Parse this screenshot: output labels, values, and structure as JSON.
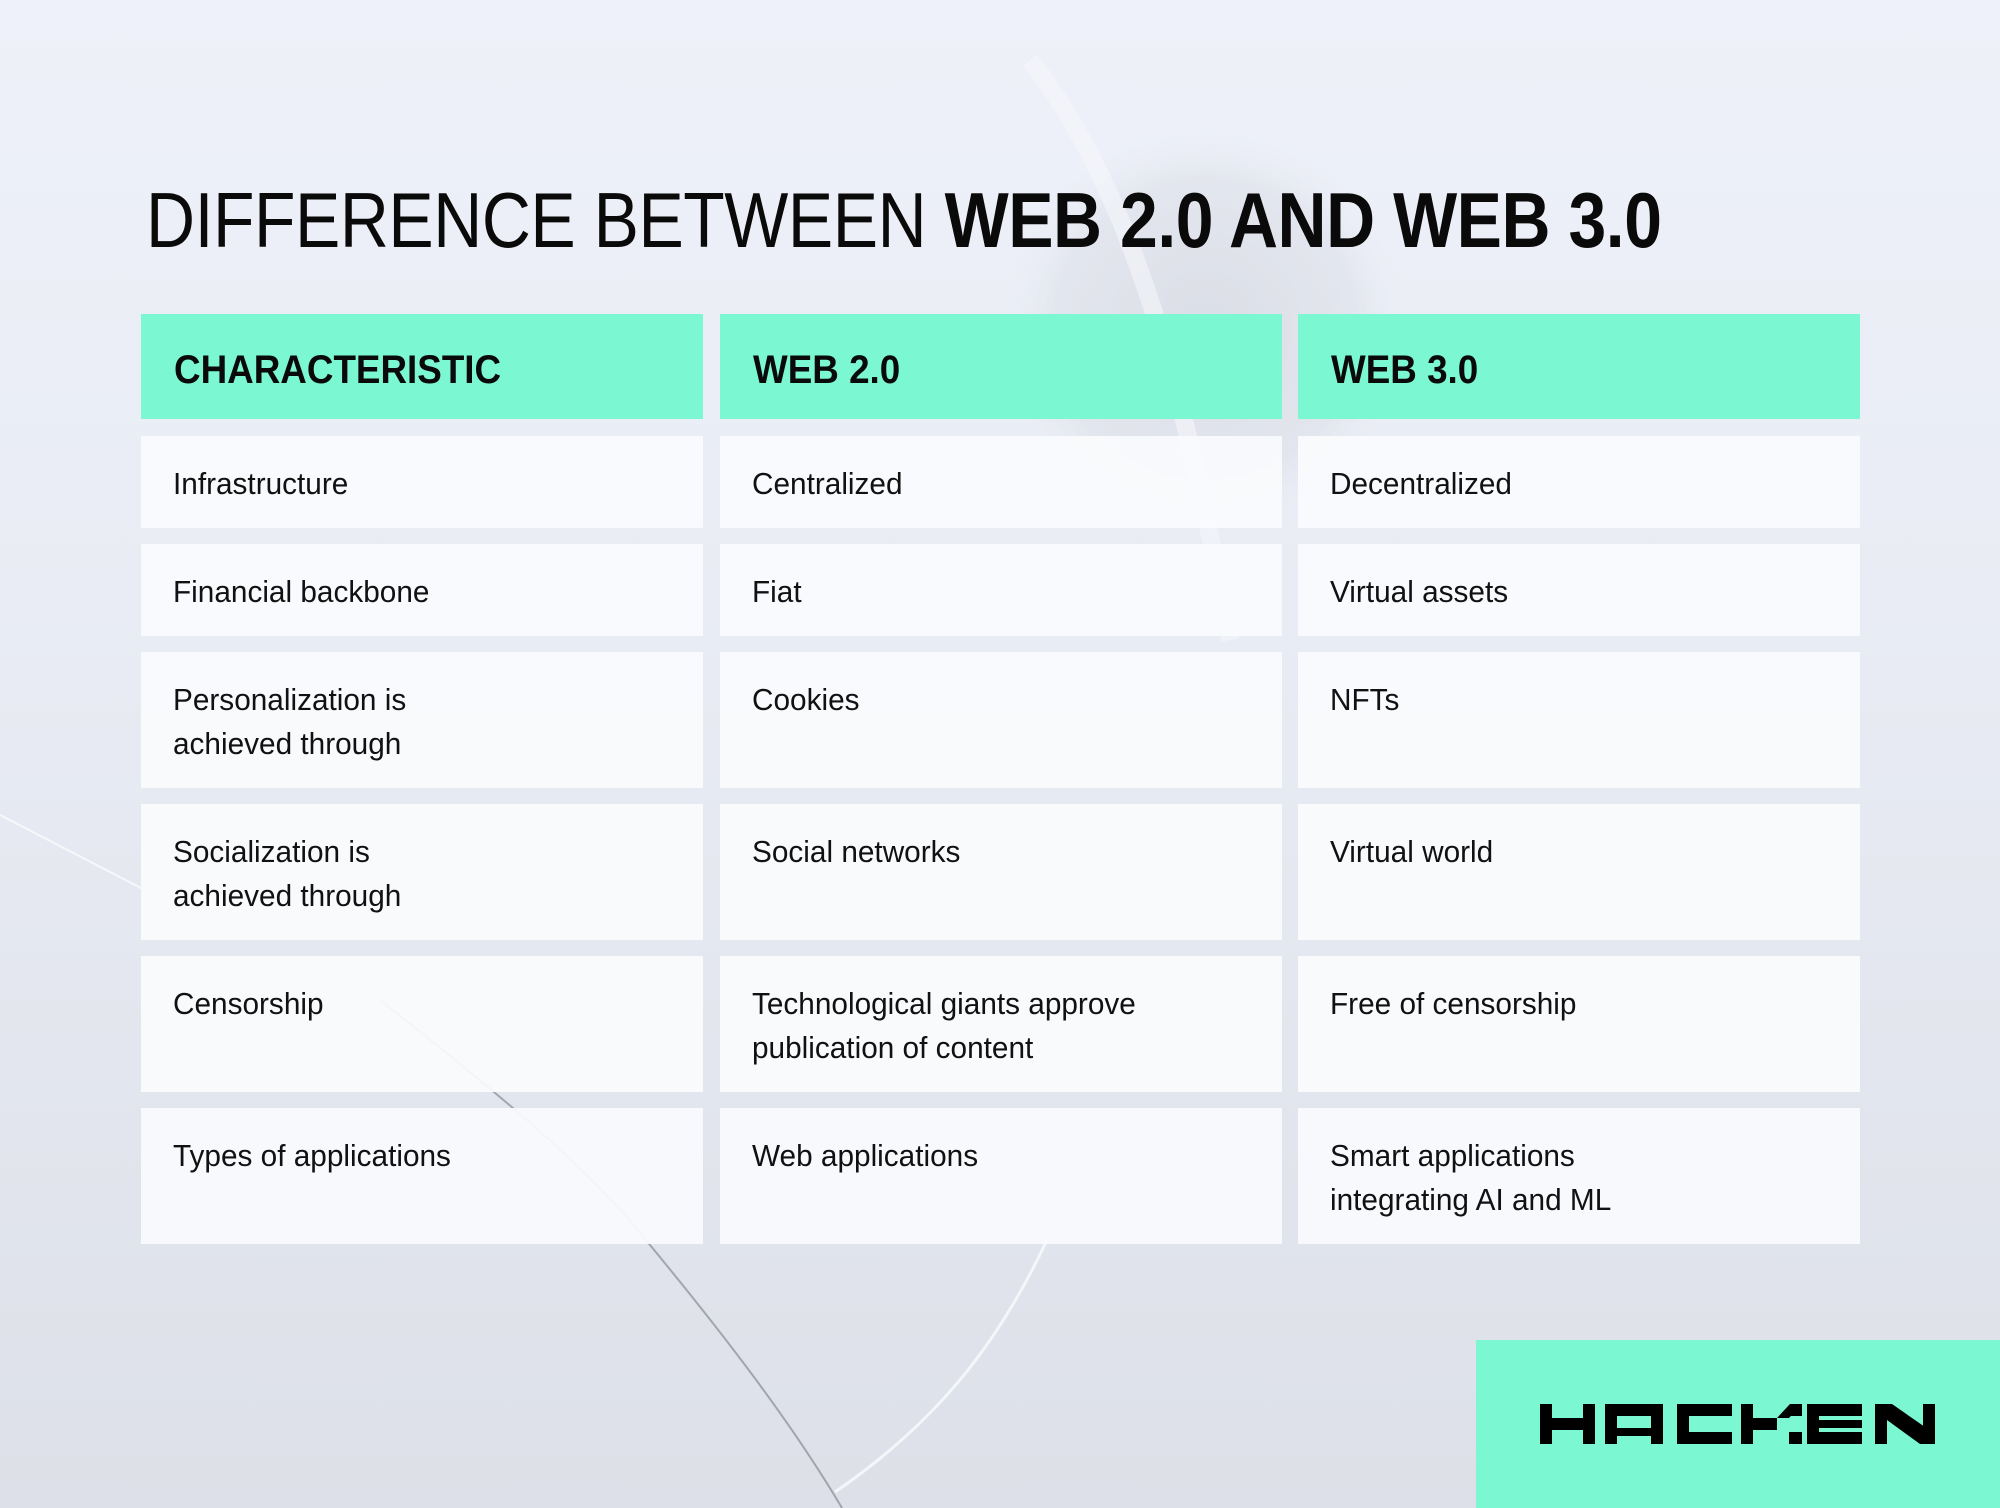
{
  "title": {
    "light": "DIFFERENCE BETWEEN ",
    "bold": "WEB 2.0 AND WEB 3.0"
  },
  "table": {
    "headers": [
      "CHARACTERISTIC",
      "WEB 2.0",
      "WEB 3.0"
    ],
    "rows": [
      [
        "Infrastructure",
        "Centralized",
        "Decentralized"
      ],
      [
        "Financial backbone",
        "Fiat",
        "Virtual assets"
      ],
      [
        "Personalization is\nachieved through",
        "Cookies",
        "NFTs"
      ],
      [
        "Socialization is\nachieved through",
        "Social networks",
        "Virtual world"
      ],
      [
        "Censorship",
        "Technological giants approve\npublication of content",
        "Free of censorship"
      ],
      [
        "Types of applications",
        "Web applications",
        "Smart applications\nintegrating AI and ML"
      ]
    ]
  },
  "brand": {
    "name": "HACKEN",
    "accent_color": "#7bf7d2",
    "logo_icon": "hacken-wordmark-icon"
  }
}
